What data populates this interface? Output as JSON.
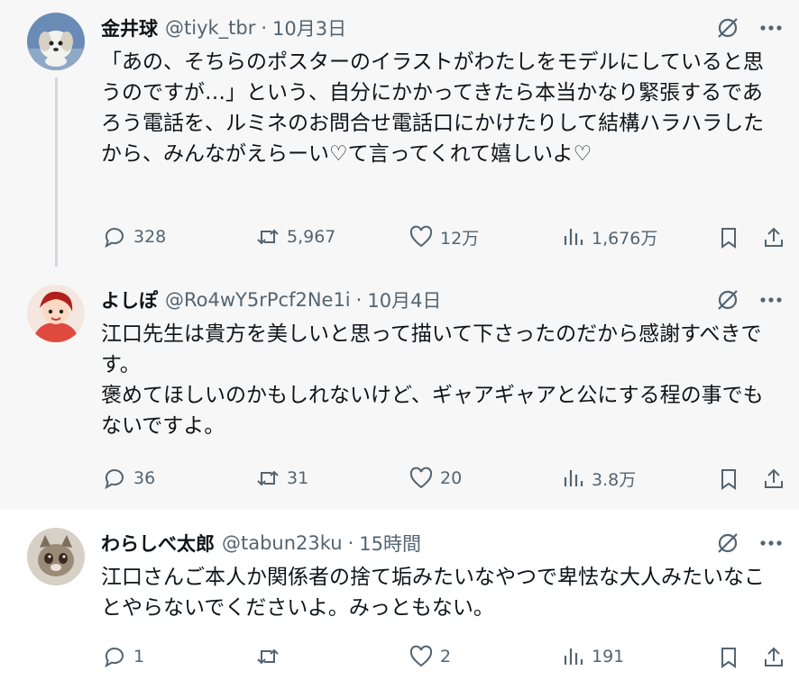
{
  "tweets": [
    {
      "name": "金井球",
      "handle": "@tiyk_tbr",
      "separator": "·",
      "date": "10月3日",
      "text": "「あの、そちらのポスターのイラストがわたしをモデルにしていると思うのですが…」という、自分にかかってきたら本当かなり緊張するであろう電話を、ルミネのお問合せ電話口にかけたりして結構ハラハラしたから、みんながえらーい♡て言ってくれて嬉しいよ♡",
      "replies": "328",
      "retweets": "5,967",
      "likes": "12万",
      "views": "1,676万"
    },
    {
      "name": "よしぽ",
      "handle": "@Ro4wY5rPcf2Ne1i",
      "separator": "·",
      "date": "10月4日",
      "text": "江口先生は貴方を美しいと思って描いて下さったのだから感謝すべきです。\n褒めてほしいのかもしれないけど、ギャアギャアと公にする程の事でもないですよ。",
      "replies": "36",
      "retweets": "31",
      "likes": "20",
      "views": "3.8万"
    },
    {
      "name": "わらしべ太郎",
      "handle": "@tabun23ku",
      "separator": "·",
      "date": "15時間",
      "text": "江口さんご本人か関係者の捨て垢みたいなやつで卑怯な大人みたいなことやらないでくださいよ。みっともない。",
      "replies": "1",
      "retweets": "",
      "likes": "2",
      "views": "191"
    }
  ],
  "colors": {
    "text": "#0f1419",
    "secondary": "#536471",
    "thread_line": "#cfd9de",
    "shaded_bg": "#f7f7f7"
  },
  "icons": [
    "reply-icon",
    "retweet-icon",
    "like-icon",
    "views-icon",
    "bookmark-icon",
    "share-icon",
    "grok-icon",
    "more-icon"
  ]
}
